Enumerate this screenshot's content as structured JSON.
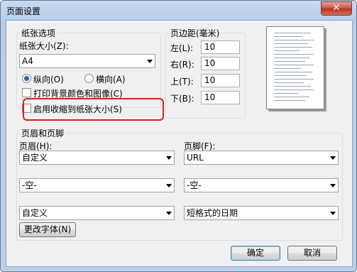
{
  "window": {
    "title": "页面设置",
    "close_glyph": "✕"
  },
  "paper": {
    "group_label": "纸张选项",
    "size_label": "纸张大小(Z):",
    "size_value": "A4",
    "portrait_label": "纵向(O)",
    "landscape_label": "横向(A)",
    "print_background_label": "打印背景颜色和图像(C)",
    "shrink_to_fit_label": "启用收缩到纸张大小(S)"
  },
  "margins": {
    "group_label": "页边距(毫米)",
    "left_label": "左(L):",
    "left_value": "10",
    "right_label": "右(R):",
    "right_value": "10",
    "top_label": "上(T):",
    "top_value": "10",
    "bottom_label": "下(B):",
    "bottom_value": "10"
  },
  "header_footer": {
    "group_label": "页眉和页脚",
    "header_label": "页眉(H):",
    "footer_label": "页脚(F):",
    "header_1": "自定义",
    "footer_1": "URL",
    "header_2": "-空-",
    "footer_2": "-空-",
    "header_3": "自定义",
    "footer_3": "短格式的日期",
    "change_font_label": "更改字体(N)"
  },
  "buttons": {
    "ok": "确定",
    "cancel": "取消"
  },
  "colors": {
    "highlight": "#e11a1a",
    "title_bar": "#c7daf0",
    "close_button": "#c8503f"
  }
}
